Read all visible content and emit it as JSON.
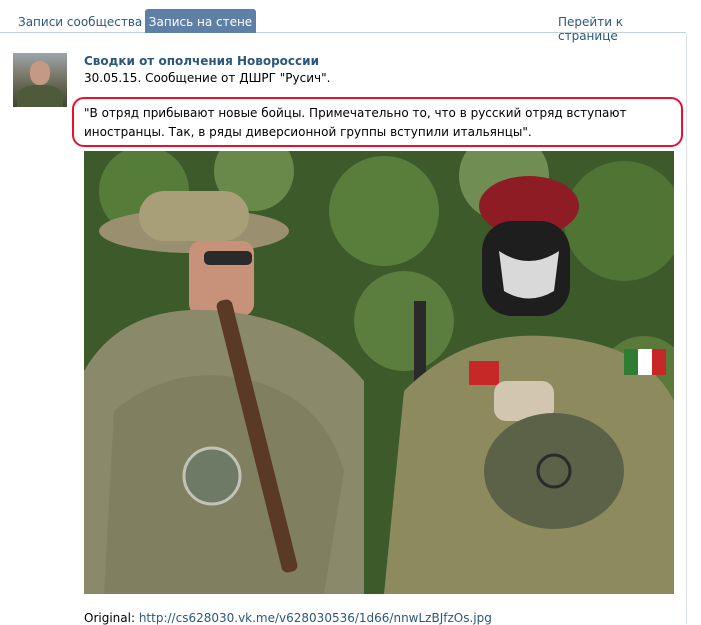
{
  "tabs": {
    "community_posts": "Записи сообщества",
    "wall_post": "Запись на стене",
    "go_to_page": "Перейти к странице"
  },
  "post": {
    "author": "Сводки от ополчения Новороссии",
    "meta": "30.05.15. Сообщение от ДШРГ \"Русич\".",
    "text": "\"В отряд прибывают новые бойцы. Примечательно то, что в русский отряд вступают иностранцы. Так, в ряды диверсионной группы вступили итальянцы\".",
    "original_label": "Original:",
    "original_link": "http://cs628030.vk.me/v628030536/1d66/nnwLzBJfzOs.jpg"
  },
  "colors": {
    "link": "#2b587a",
    "active_tab": "#5e80a6",
    "highlight": "#e8102e"
  }
}
